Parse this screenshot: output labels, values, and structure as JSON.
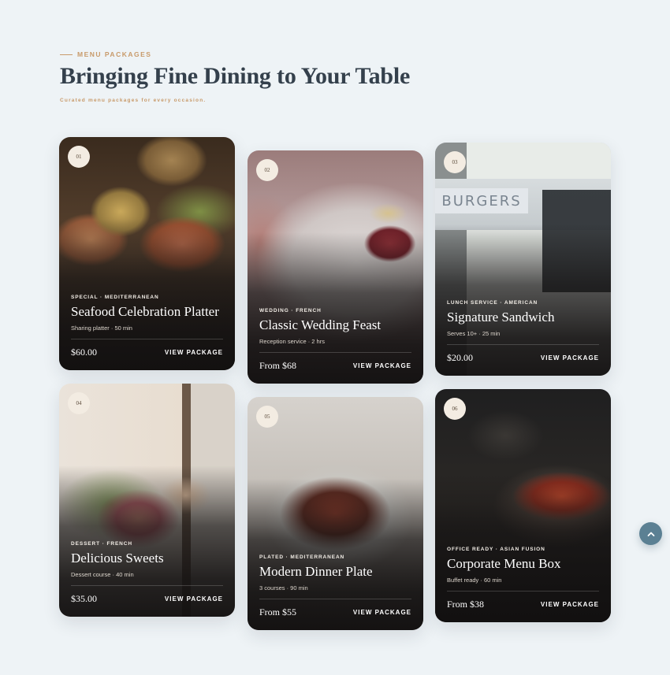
{
  "header": {
    "eyebrow": "MENU PACKAGES",
    "title": "Bringing Fine Dining to Your Table",
    "subtitle": "Curated menu packages for every occasion."
  },
  "cards": [
    {
      "num": "01",
      "tag": "SPECIAL · MEDITERRANEAN",
      "name": "Seafood Celebration Platter",
      "meta": "Sharing platter · 50 min",
      "price": "$60.00",
      "cta": "VIEW PACKAGE"
    },
    {
      "num": "02",
      "tag": "WEDDING · FRENCH",
      "name": "Classic Wedding Feast",
      "meta": "Reception service · 2 hrs",
      "price": "From $68",
      "cta": "VIEW PACKAGE"
    },
    {
      "num": "03",
      "tag": "LUNCH SERVICE · AMERICAN",
      "name": "Signature Sandwich",
      "meta": "Serves 10+ · 25 min",
      "price": "$20.00",
      "cta": "VIEW PACKAGE",
      "sign": "BURGERS"
    },
    {
      "num": "04",
      "tag": "DESSERT · FRENCH",
      "name": "Delicious Sweets",
      "meta": "Dessert course · 40 min",
      "price": "$35.00",
      "cta": "VIEW PACKAGE"
    },
    {
      "num": "05",
      "tag": "PLATED · MEDITERRANEAN",
      "name": "Modern Dinner Plate",
      "meta": "3 courses · 90 min",
      "price": "From $55",
      "cta": "VIEW PACKAGE"
    },
    {
      "num": "06",
      "tag": "OFFICE READY · ASIAN FUSION",
      "name": "Corporate Menu Box",
      "meta": "Buffet ready · 60 min",
      "price": "From $38",
      "cta": "VIEW PACKAGE"
    }
  ],
  "scroll_top": {
    "icon": "chevron-up-icon"
  }
}
